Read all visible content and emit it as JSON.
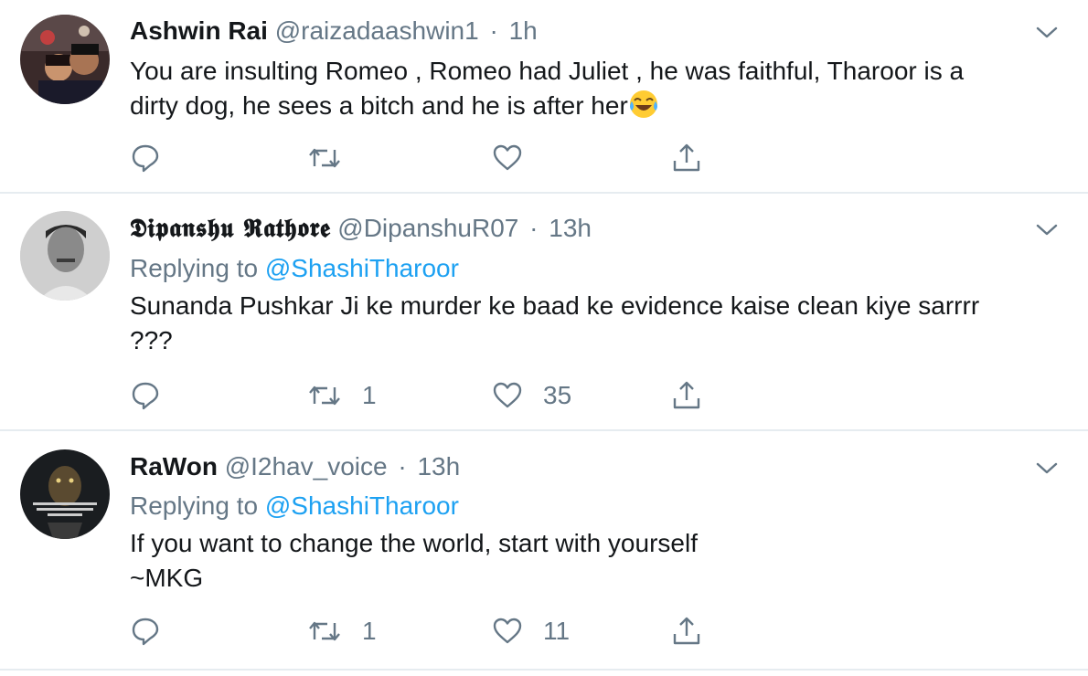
{
  "tweets": [
    {
      "name": "Ashwin Rai",
      "handle": "@raizadaashwin1",
      "separator": "·",
      "time": "1h",
      "reply_prefix": "",
      "reply_mention": "",
      "text_lines": [
        "You are insulting Romeo , Romeo had Juliet , he was faithful, Tharoor is a",
        "dirty dog, he sees a bitch and he is after her"
      ],
      "emoji": "face-with-tears-of-joy",
      "retweets": "",
      "likes": ""
    },
    {
      "name": "𝕯𝖎𝖕𝖆𝖓𝖘𝖍𝖚 𝕽𝖆𝖙𝖍𝖔𝖗𝖊",
      "handle": "@DipanshuR07",
      "separator": "·",
      "time": "13h",
      "reply_prefix": "Replying to ",
      "reply_mention": "@ShashiTharoor",
      "text_lines": [
        "Sunanda Pushkar Ji ke murder ke baad ke evidence kaise clean kiye sarrrr",
        "???"
      ],
      "retweets": "1",
      "likes": "35"
    },
    {
      "name": "RaWon",
      "handle": "@I2hav_voice",
      "separator": "·",
      "time": "13h",
      "reply_prefix": "Replying to ",
      "reply_mention": "@ShashiTharoor",
      "text_lines": [
        "If you want to change the world, start with yourself",
        "~MKG"
      ],
      "retweets": "1",
      "likes": "11"
    }
  ],
  "icons": {
    "reply": "reply-icon",
    "retweet": "retweet-icon",
    "like": "like-icon",
    "share": "share-icon",
    "more": "chevron-down-icon"
  },
  "colors": {
    "text": "#14171a",
    "secondary": "#657786",
    "link": "#1da1f2",
    "divider": "#e6ecf0"
  }
}
